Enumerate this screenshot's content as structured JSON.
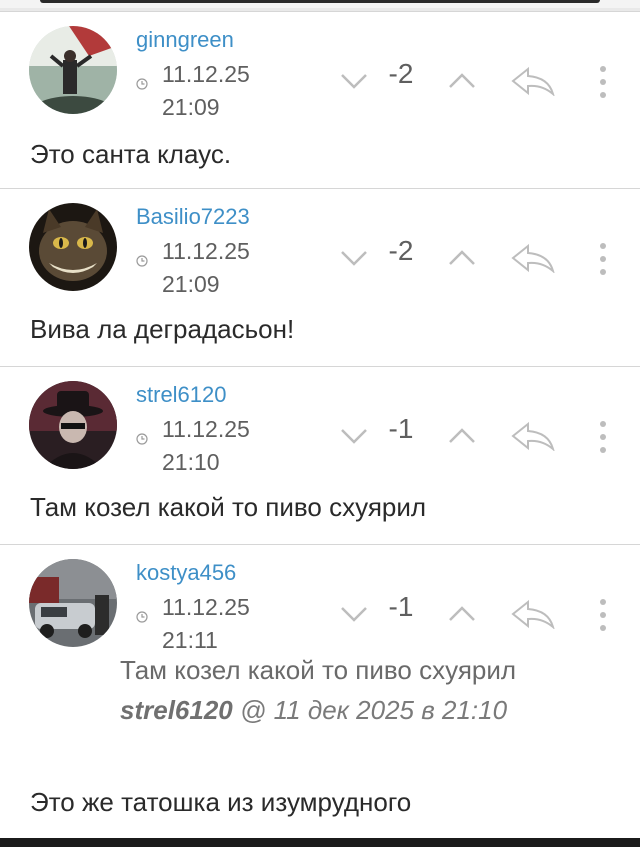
{
  "comments": [
    {
      "username": "ginngreen",
      "date": "11.12.25",
      "time": "21:09",
      "score": "-2",
      "text": "Это санта клаус."
    },
    {
      "username": "Basilio7223",
      "date": "11.12.25",
      "time": "21:09",
      "score": "-2",
      "text": "Вива ла деградасьон!"
    },
    {
      "username": "strel6120",
      "date": "11.12.25",
      "time": "21:10",
      "score": "-1",
      "text": "Там козел какой то пиво схуярил"
    },
    {
      "username": "kostya456",
      "date": "11.12.25",
      "time": "21:11",
      "score": "-1",
      "quote": {
        "text": "Там козел какой то пиво схуярил",
        "author": "strel6120",
        "meta": " @ 11 дек 2025 в 21:10"
      },
      "text": "Это же татошка из изумрудного"
    }
  ],
  "icons": {
    "clock": "clock-icon",
    "down": "chevron-down-icon",
    "up": "chevron-up-icon",
    "reply": "reply-arrow-icon",
    "more": "more-vertical-icon"
  },
  "colors": {
    "username": "#3e8fc7",
    "text": "#2a2a2a",
    "meta": "#5f5f5f",
    "icon": "#bdbdbd"
  }
}
